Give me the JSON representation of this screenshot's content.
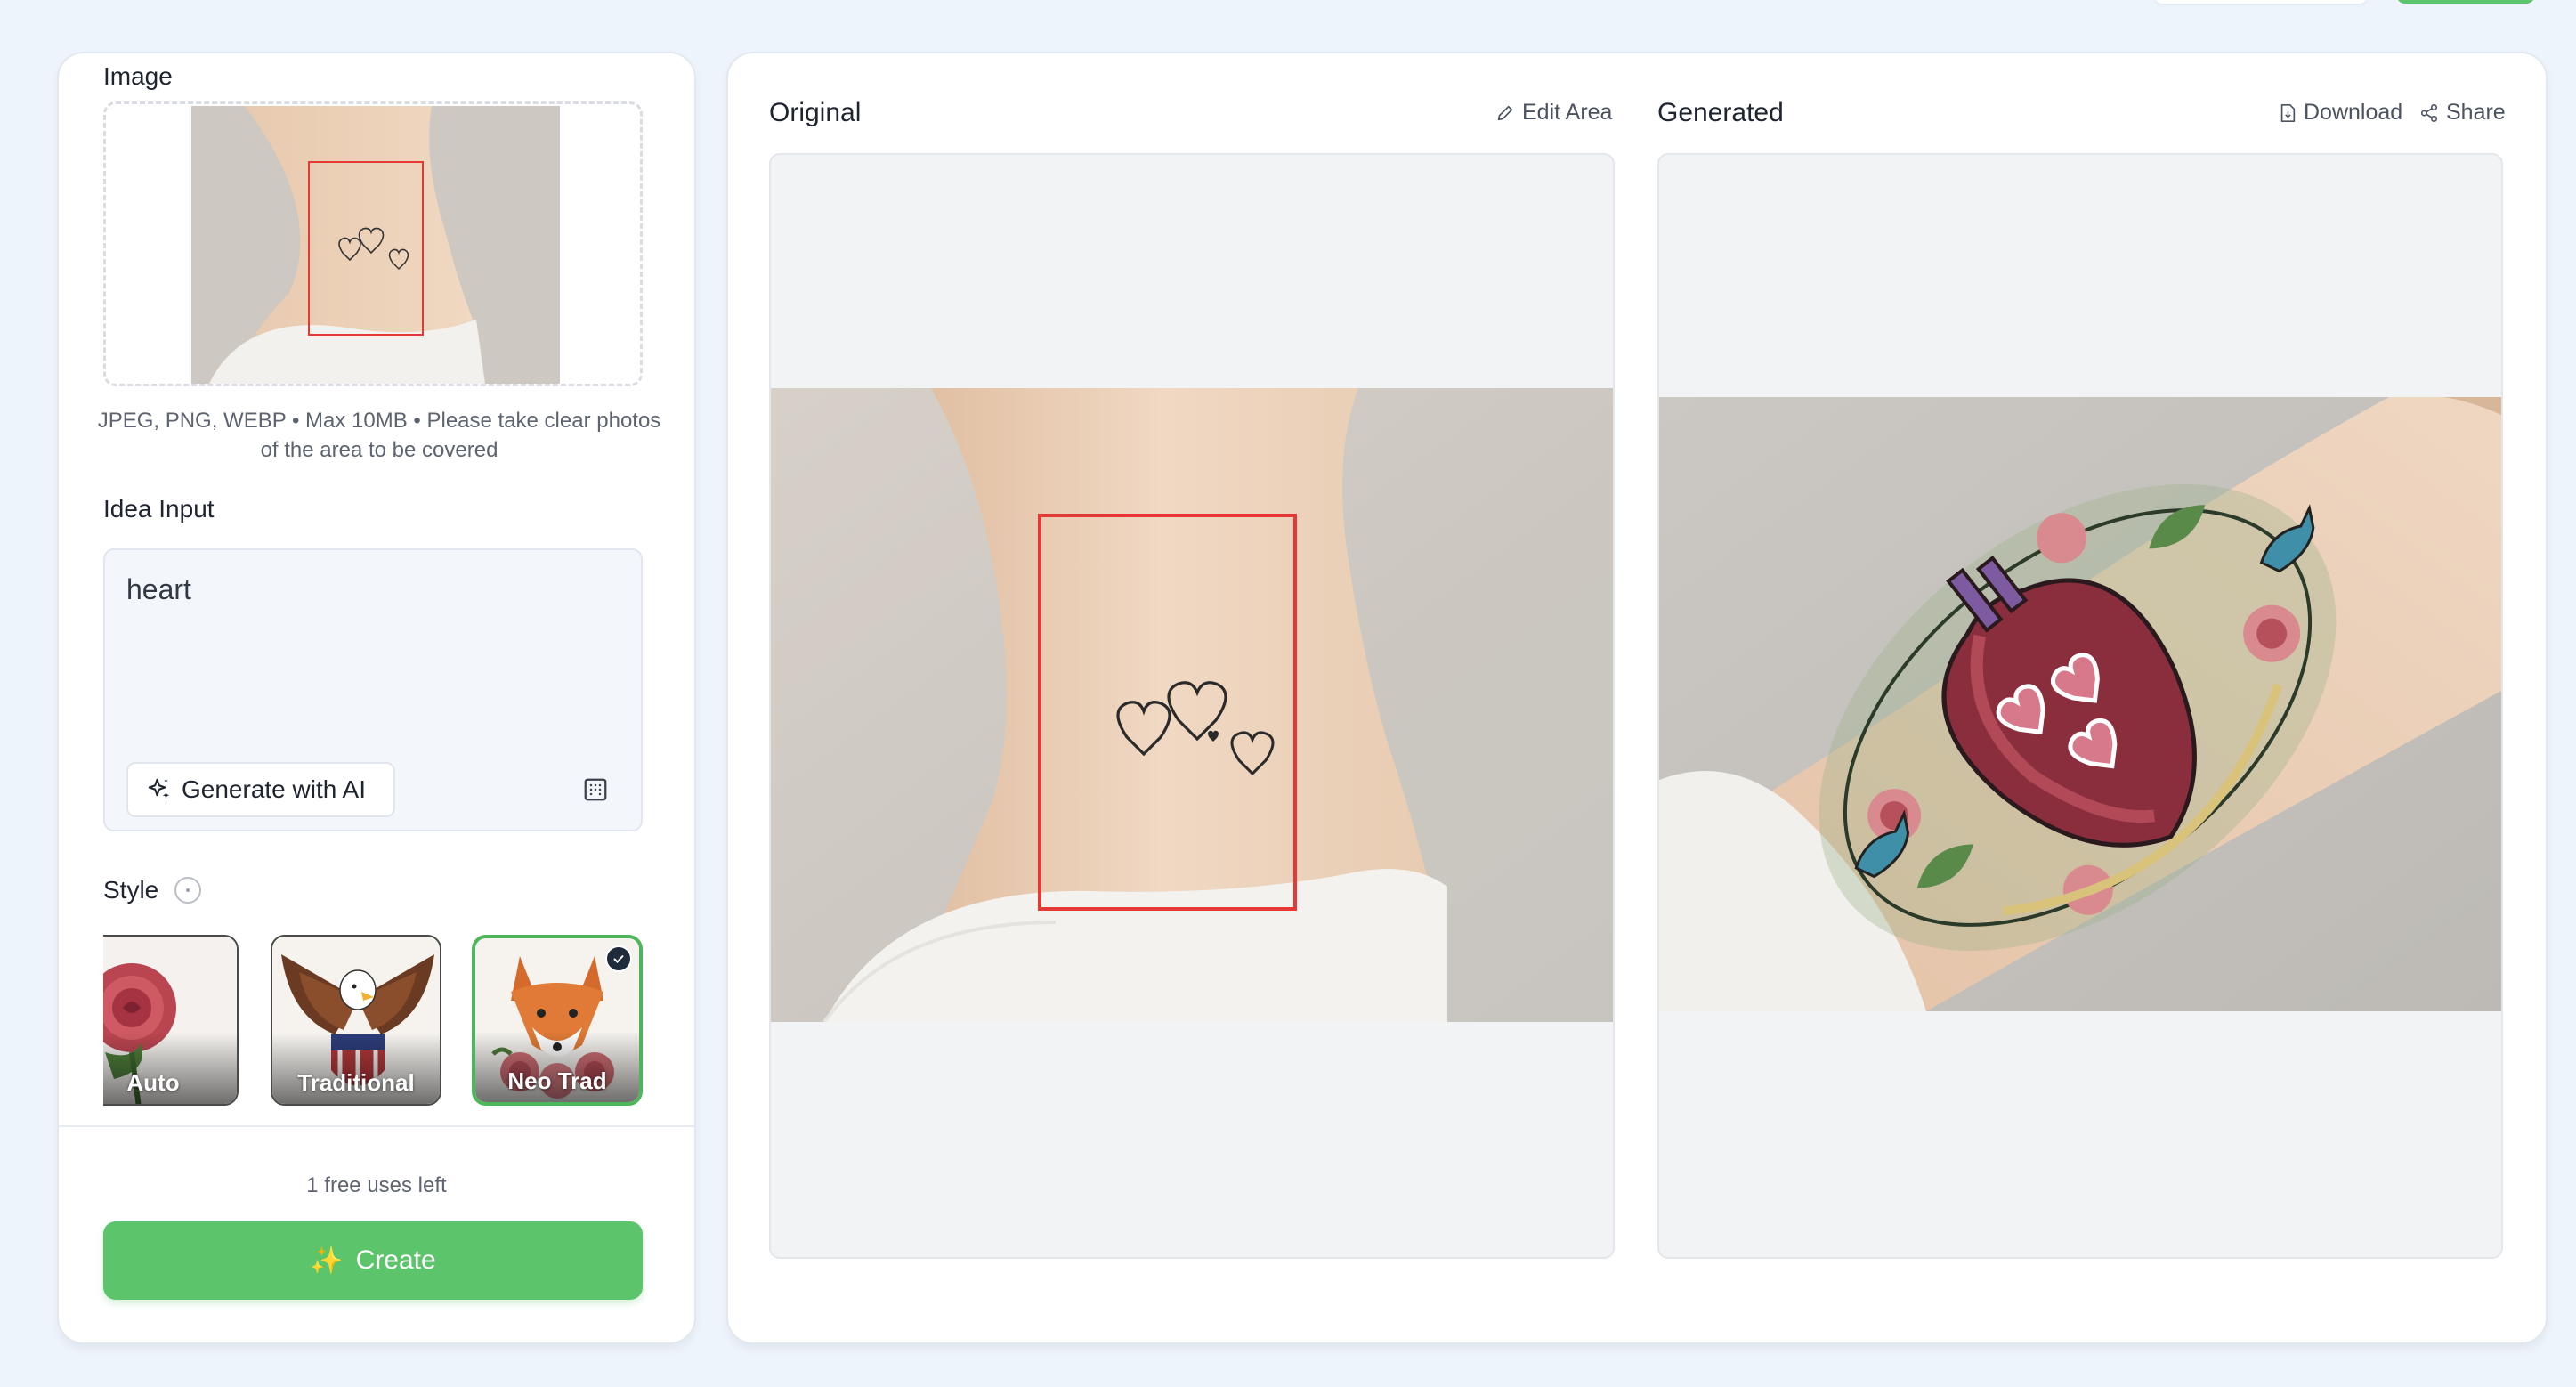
{
  "left_panel": {
    "image_label": "Image",
    "upload_hint": "JPEG, PNG, WEBP • Max 10MB • Please take clear photos of the area to be covered",
    "idea_label": "Idea Input",
    "idea_value": "heart",
    "generate_ai_label": "Generate with AI",
    "style_label": "Style",
    "styles": [
      {
        "label": "Auto",
        "selected": false
      },
      {
        "label": "Traditional",
        "selected": false
      },
      {
        "label": "Neo Trad",
        "selected": true
      }
    ],
    "free_uses": "1 free uses left",
    "create_label": "Create",
    "create_icon": "✨"
  },
  "right_panel": {
    "original_title": "Original",
    "edit_area_label": "Edit Area",
    "generated_title": "Generated",
    "download_label": "Download",
    "share_label": "Share"
  },
  "colors": {
    "accent_green": "#5cc46a",
    "selection_red": "#e53935",
    "background": "#eef4fb"
  }
}
